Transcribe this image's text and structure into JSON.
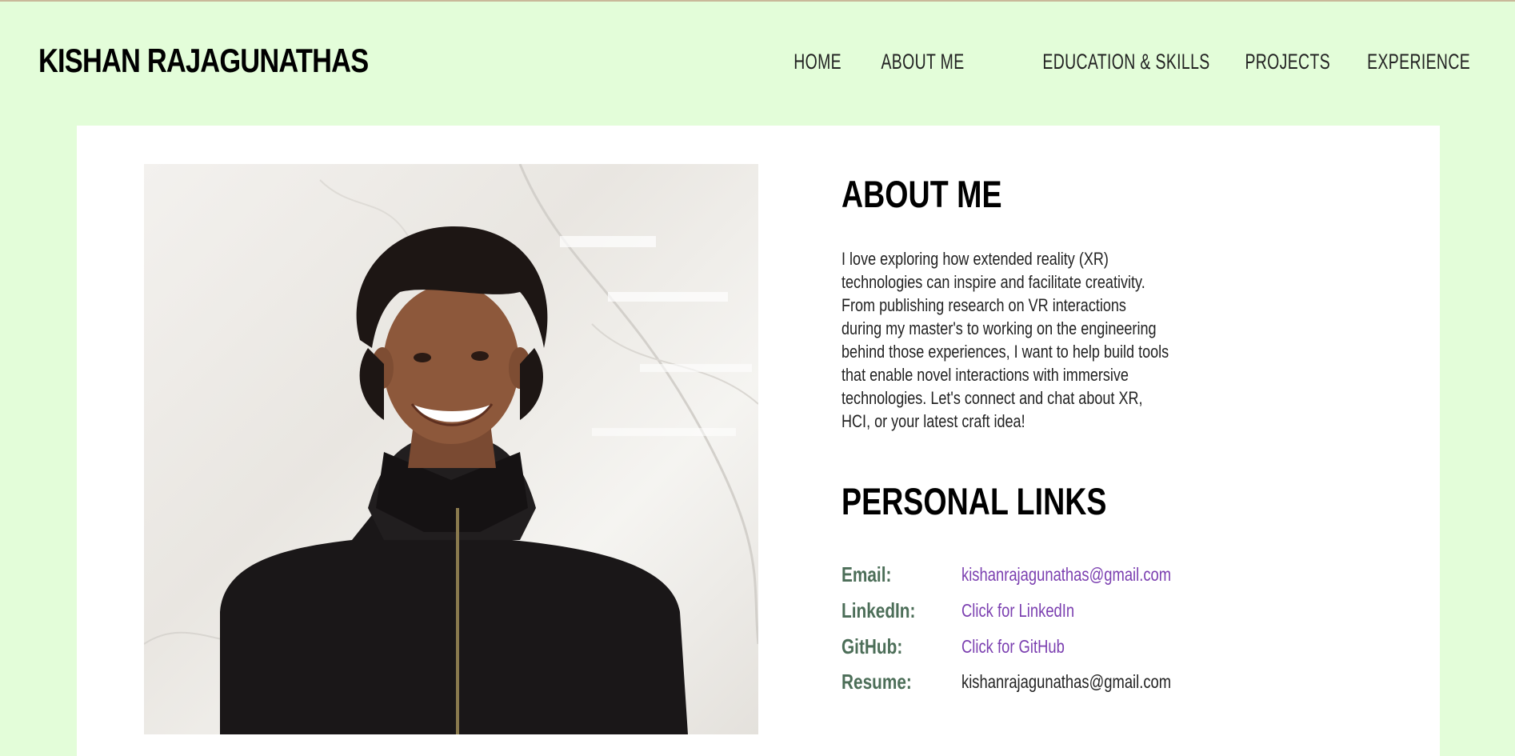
{
  "header": {
    "site_title": "KISHAN RAJAGUNATHAS",
    "nav": [
      {
        "label": "HOME"
      },
      {
        "label": "ABOUT ME"
      },
      {
        "label": "EDUCATION & SKILLS"
      },
      {
        "label": "PROJECTS"
      },
      {
        "label": "EXPERIENCE"
      }
    ]
  },
  "about": {
    "heading": "ABOUT ME",
    "text": "I love exploring how extended reality (XR) technologies can inspire and facilitate creativity. From publishing research on VR interactions during my master's to working on the engineering behind those experiences, I want to help build tools that enable novel interactions with immersive technologies. Let's connect and chat about XR, HCI, or your latest craft idea!"
  },
  "links": {
    "heading": "PERSONAL LINKS",
    "rows": [
      {
        "label": "Email:",
        "value": "kishanrajagunathas@gmail.com"
      },
      {
        "label": "LinkedIn:",
        "value": "Click for LinkedIn"
      },
      {
        "label": "GitHub:",
        "value": "Click for GitHub"
      },
      {
        "label": "Resume:",
        "value": "kishanrajagunathas@gmail.com"
      }
    ]
  },
  "photo": {
    "icon": "profile-photo"
  },
  "colors": {
    "background": "#e3fdd9",
    "card": "#ffffff",
    "label": "#4c6e58",
    "link": "#7b3fb0"
  }
}
